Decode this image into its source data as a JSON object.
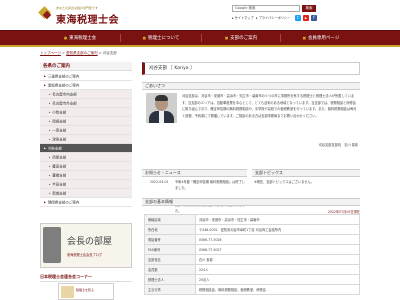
{
  "header": {
    "tagline": "あなたの身近な税の専門家です",
    "site_name": "東海税理士会",
    "search": {
      "value": "Google 検索",
      "button": "検索"
    },
    "top_links": [
      "サイトマップ",
      "プライバシーポリシー"
    ],
    "sns": [
      {
        "icon": "twitter-icon",
        "color": "#1da1f2",
        "glyph": "t"
      },
      {
        "icon": "youtube-icon",
        "color": "#e62117",
        "glyph": "▶"
      },
      {
        "icon": "facebook-icon",
        "color": "#3b5998",
        "glyph": "f"
      }
    ]
  },
  "nav": [
    "東海税理士会",
    "税理士について",
    "支部のご案内",
    "会員専用ページ"
  ],
  "breadcrumb": {
    "home": "トップページ",
    "sep1": " > ",
    "parent": "愛知県支部のご案内",
    "sep2": " > ",
    "current": "刈谷支部"
  },
  "sidebar": {
    "heading": "各県のご案内",
    "items": [
      {
        "label": "三重県支部のご案内",
        "type": "item"
      },
      {
        "label": "愛知県支部のご案内",
        "type": "item"
      },
      {
        "label": "名古屋市内支部",
        "type": "sub"
      },
      {
        "label": "名古屋市外支部",
        "type": "sub"
      },
      {
        "label": "小牧支部",
        "type": "sub"
      },
      {
        "label": "岡崎支部",
        "type": "sub"
      },
      {
        "label": "一宮支部",
        "type": "sub"
      },
      {
        "label": "津島支部",
        "type": "sub"
      },
      {
        "label": "刈谷支部",
        "type": "selected"
      },
      {
        "label": "西尾支部",
        "type": "sub"
      },
      {
        "label": "豊田支部",
        "type": "sub"
      },
      {
        "label": "豊橋支部",
        "type": "sub"
      },
      {
        "label": "半田支部",
        "type": "sub"
      },
      {
        "label": "新城支部",
        "type": "sub"
      },
      {
        "label": "静岡県支部のご案内",
        "type": "item"
      }
    ],
    "banner": {
      "title": "会長の部屋",
      "subtitle": "東海税理士会会長ブログ"
    },
    "league_heading": "日本税理士会連合会コーナー",
    "league_text": "税理士を知る"
  },
  "main": {
    "title": "刈谷支部 ［ Kariya ］",
    "greeting_heading": "ごあいさつ",
    "greeting_text": "刈谷支部は、刈谷市・安城市・高浜市・知立市・碧南市の５つの市に事務所を有する税理士と税理士法人が所属しています。当支部のエリアは、自動車産業を中心として、とても活気のある地域となっています。当支部では、税務相談と研修会に取り組んでおり、確定申告期の無料税務相談や、中学校や高校での租税教室を行っています。また、無料税務相談は毎月１回程、予約制にて開催しています。ご相談のある方は支部事務局までお問い合わせください。",
    "greeting_sign": "刈谷支部支部長　石川 泰慶",
    "news_heading": "お知らせ・ニュース",
    "news": [
      {
        "date": "2022-04-01",
        "text": "令和4年度「確定申告期 無料税務相談」は終了しました。"
      },
      {
        "date": "2021-07-08",
        "text": "支部の最新情報と税務相談のご案内を更新しました。"
      }
    ],
    "topics_heading": "支部トピックス",
    "topics_text": "※現在、支部トピックスはございません。",
    "info_heading": "支部の基本情報",
    "updated": "2022年07月05日現在",
    "info": [
      {
        "key": "管轄区域",
        "value": "刈谷市・安城市・高浜市・知立市・碧南市"
      },
      {
        "key": "所在地",
        "value": "〒448-0032　愛知県刈谷市幸町1丁目 刈谷商工会議所内"
      },
      {
        "key": "電話番号",
        "value": "0566-77-5026"
      },
      {
        "key": "FAX番号",
        "value": "0566-77-5027"
      },
      {
        "key": "支部長名",
        "value": "石川 泰慶"
      },
      {
        "key": "会員数",
        "value": "224人"
      },
      {
        "key": "税理士法人",
        "value": "25法人"
      },
      {
        "key": "主な行事",
        "value": "税務相談会、無料税務相談、租税教室、研修会"
      }
    ]
  },
  "colors": {
    "brand": "#7a1212",
    "accent": "#c9a52a"
  }
}
